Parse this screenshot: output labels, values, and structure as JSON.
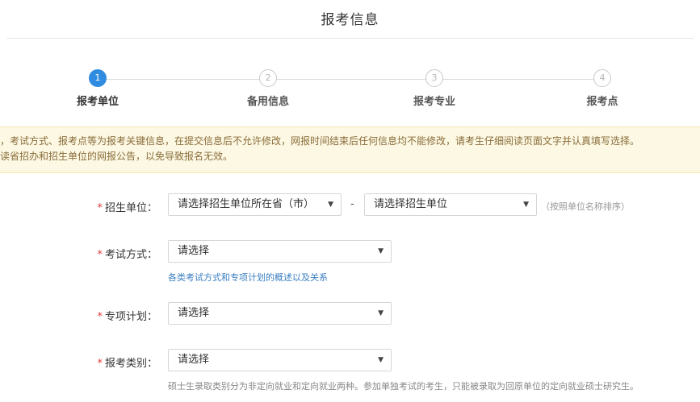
{
  "header": {
    "title": "报考信息"
  },
  "steps": [
    {
      "number": "1",
      "label": "报考单位",
      "active": true
    },
    {
      "number": "2",
      "label": "备用信息",
      "active": false
    },
    {
      "number": "3",
      "label": "报考专业",
      "active": false
    },
    {
      "number": "4",
      "label": "报考点",
      "active": false
    }
  ],
  "notice": {
    "line1": "，考试方式、报考点等为报考关键信息，在提交信息后不允许修改，网报时间结束后任何信息均不能修改，请考生仔细阅读页面文字并认真填写选择。",
    "line2": "读省招办和招生单位的网报公告，以免导致报名无效。"
  },
  "form": {
    "required_mark": "*",
    "recruit_unit": {
      "label": "招生单位：",
      "province_select": "请选择招生单位所在省（市）",
      "separator": "-",
      "unit_select": "请选择招生单位",
      "hint": "（按照单位名称排序）"
    },
    "exam_mode": {
      "label": "考试方式：",
      "select": "请选择",
      "link": "各类考试方式和专项计划的概述以及关系"
    },
    "special_plan": {
      "label": "专项计划：",
      "select": "请选择"
    },
    "apply_category": {
      "label": "报考类别：",
      "select": "请选择",
      "hint": "硕士生录取类别分为非定向就业和定向就业两种。参加单独考试的考生，只能被录取为回原单位的定向就业硕士研究生。"
    },
    "caret_icon": "▼"
  },
  "colors": {
    "active_step": "#2f8ce0",
    "notice_bg": "#fcf8e3",
    "notice_text": "#8a6d3b",
    "required": "#e03a3a",
    "link": "#3a7fc1"
  }
}
